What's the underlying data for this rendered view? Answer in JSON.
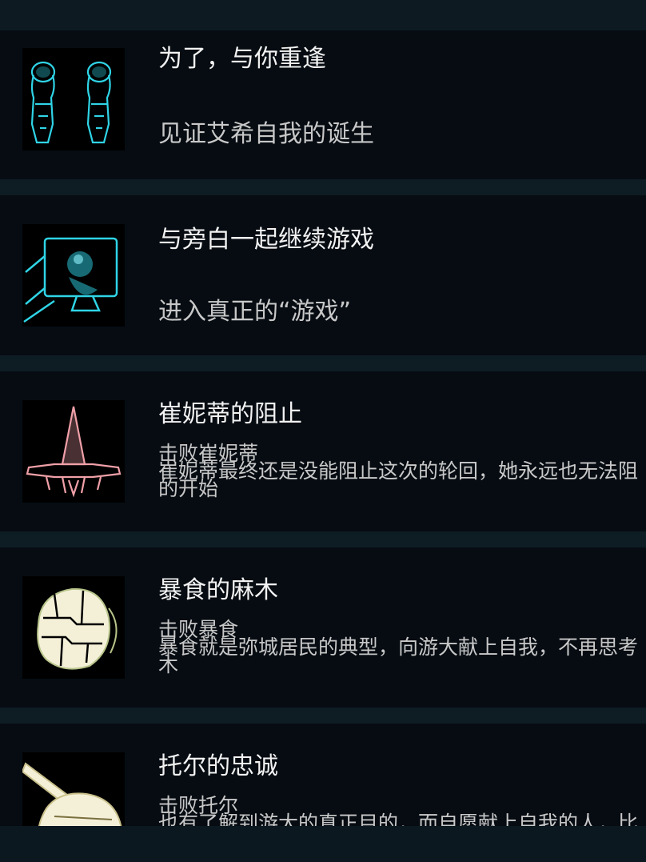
{
  "achievements": [
    {
      "title": "为了，与你重逢",
      "subtitle": "见证艾希自我的诞生",
      "icon": "twin-figures-icon"
    },
    {
      "title": "与旁白一起继续游戏",
      "subtitle": "进入真正的“游戏”",
      "icon": "monitor-hologram-icon"
    },
    {
      "title": "崔妮蒂的阻止",
      "condition": "击败崔妮蒂",
      "desc_line1": "崔妮蒂最终还是没能阻止这次的轮回，她永远也无法阻",
      "desc_line2": "的开始",
      "icon": "starship-icon"
    },
    {
      "title": "暴食的麻木",
      "condition": "击败暴食",
      "desc_line1": "暴食就是弥城居民的典型，向游大献上自我，不再思考",
      "desc_line2": "木",
      "icon": "armored-sphere-icon"
    },
    {
      "title": "托尔的忠诚",
      "condition": "击败托尔",
      "desc_line1": "也有了解到游大的真正目的，而自愿献上自我的人，比",
      "icon": "cannon-icon"
    }
  ],
  "colors": {
    "card_bg": "#060c12",
    "page_bg": "#0e1c24",
    "cyan_glow": "#2fd4e6",
    "pink_glow": "#f0a0a8",
    "cream_glow": "#f4f0d8"
  }
}
